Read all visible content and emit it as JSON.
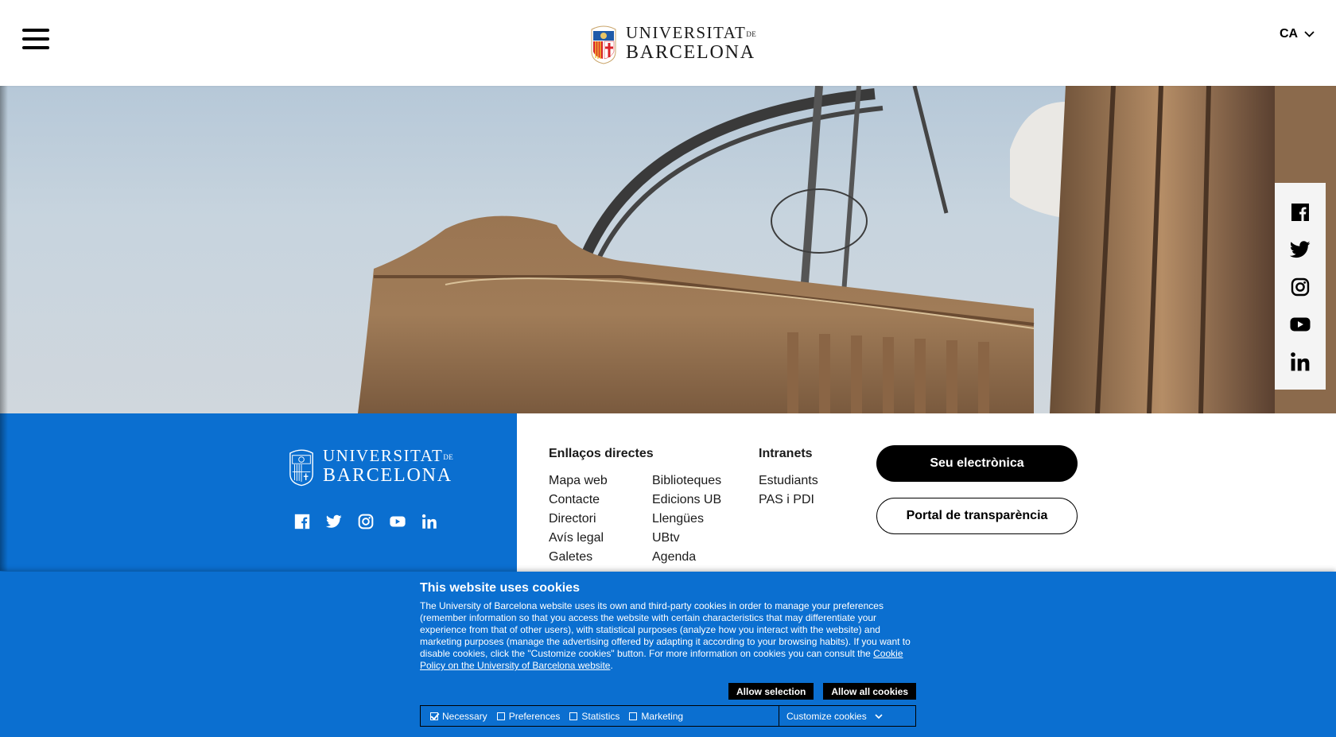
{
  "header": {
    "logo": {
      "line1": "Universitat",
      "de": "de",
      "line2": "Barcelona"
    },
    "language": "CA"
  },
  "social": [
    "facebook-icon",
    "twitter-icon",
    "instagram-icon",
    "youtube-icon",
    "linkedin-icon"
  ],
  "footer": {
    "direct_links_title": "Enllaços directes",
    "direct_links": [
      "Mapa web",
      "Contacte",
      "Directori",
      "Avís legal",
      "Galetes",
      "Biblioteques",
      "Edicions UB",
      "Llengües",
      "UBtv",
      "Agenda"
    ],
    "intranets_title": "Intranets",
    "intranets": [
      "Estudiants",
      "PAS i PDI"
    ],
    "seu_button": "Seu electrònica",
    "portal_button": "Portal de transparència"
  },
  "cookie": {
    "title": "This website uses cookies",
    "text": "The University of Barcelona website uses its own and third-party cookies in order to manage your preferences (remember information so that you access the website with certain characteristics that may differentiate your experience from that of other users), with statistical purposes (analyze how you interact with the website) and marketing purposes (manage the advertising offered by adapting it according to your browsing habits). If you want to disable cookies, click the \"Customize cookies\" button. For more information on cookies you can consult the ",
    "link": "Cookie Policy on the University of Barcelona website",
    "after_link": ".",
    "allow_selection": "Allow selection",
    "allow_all": "Allow all cookies",
    "options": [
      {
        "label": "Necessary",
        "checked": true
      },
      {
        "label": "Preferences",
        "checked": false
      },
      {
        "label": "Statistics",
        "checked": false
      },
      {
        "label": "Marketing",
        "checked": false
      }
    ],
    "customize": "Customize cookies"
  },
  "colors": {
    "brand_blue": "#0b6fd0",
    "black": "#000000"
  }
}
